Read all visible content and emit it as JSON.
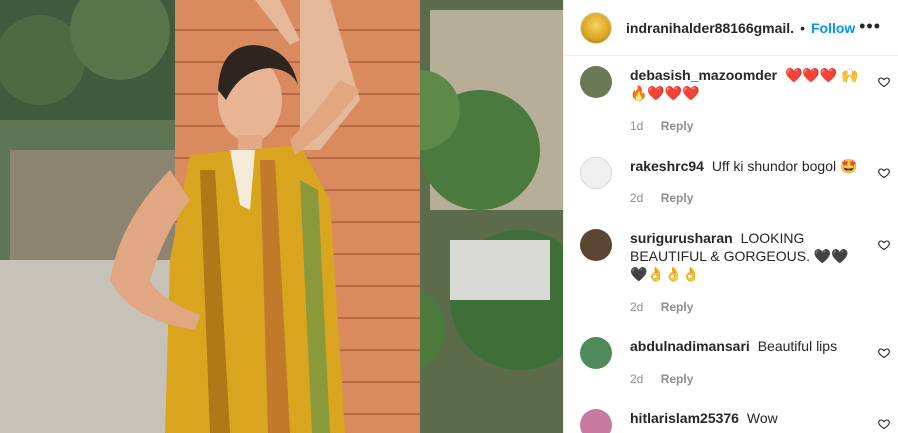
{
  "post": {
    "username": "indranihalder88166gmail.",
    "separator": "•",
    "follow_label": "Follow",
    "more_icon": "more-horizontal-icon"
  },
  "comments": [
    {
      "username": "debasish_mazoomder",
      "text": "❤️❤️❤️ 🙌 🔥❤️❤️❤️",
      "age": "1d",
      "reply_label": "Reply",
      "avatar_color": "#6b7a55"
    },
    {
      "username": "rakeshrc94",
      "text": "Uff ki shundor bogol 🤩",
      "age": "2d",
      "reply_label": "Reply",
      "avatar_color": "#dbdbdb"
    },
    {
      "username": "surigurusharan",
      "text": "LOOKING BEAUTIFUL & GORGEOUS. 🖤🖤🖤👌👌👌",
      "age": "2d",
      "reply_label": "Reply",
      "avatar_color": "#5a4632"
    },
    {
      "username": "abdulnadimansari",
      "text": "Beautiful lips",
      "age": "2d",
      "reply_label": "Reply",
      "avatar_color": "#4f8a5a"
    },
    {
      "username": "hitlarislam25376",
      "text": "Wow",
      "age": "",
      "reply_label": "",
      "avatar_color": "#c77aa0"
    }
  ]
}
